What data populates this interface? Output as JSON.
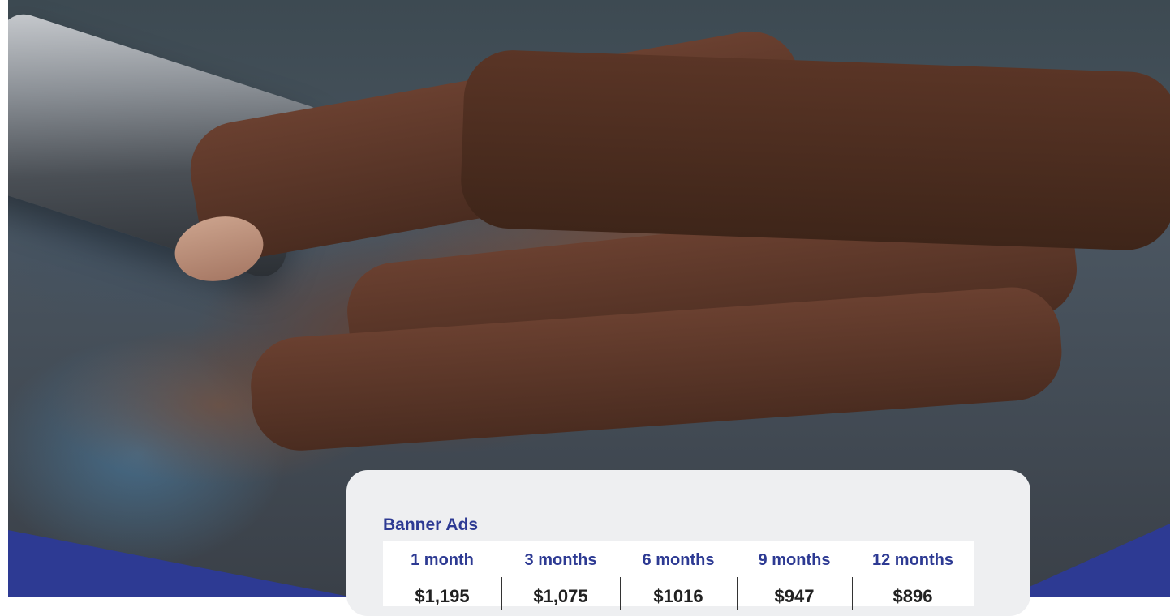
{
  "banner_ads": {
    "title": "Banner Ads",
    "plans": [
      {
        "duration": "1 month",
        "price": "$1,195"
      },
      {
        "duration": "3 months",
        "price": "$1,075"
      },
      {
        "duration": "6 months",
        "price": "$1016"
      },
      {
        "duration": "9 months",
        "price": "$947"
      },
      {
        "duration": "12 months",
        "price": "$896"
      }
    ]
  },
  "colors": {
    "brand_blue": "#2d3a93",
    "card_background": "#eeeff1"
  }
}
